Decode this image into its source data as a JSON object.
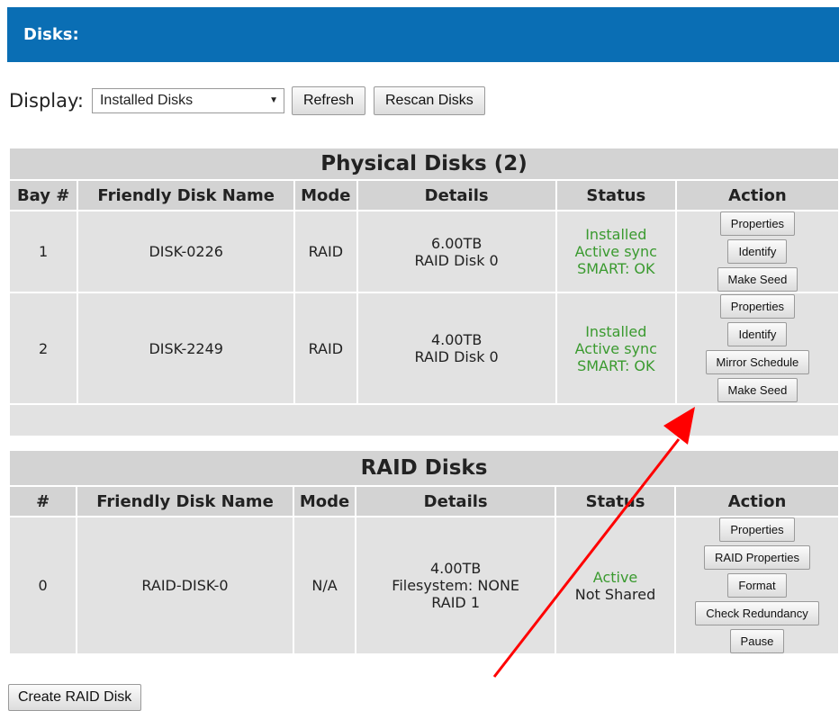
{
  "header": {
    "title": "Disks:"
  },
  "display": {
    "label": "Display:",
    "selected": "Installed Disks",
    "refresh_label": "Refresh",
    "rescan_label": "Rescan Disks"
  },
  "physical": {
    "caption": "Physical Disks (2)",
    "columns": [
      "Bay #",
      "Friendly Disk Name",
      "Mode",
      "Details",
      "Status",
      "Action"
    ],
    "rows": [
      {
        "bay": "1",
        "name": "DISK-0226",
        "mode": "RAID",
        "details": [
          "6.00TB",
          "RAID Disk 0"
        ],
        "status": [
          "Installed",
          "Active sync",
          "SMART: OK"
        ],
        "actions": [
          "Properties",
          "Identify",
          "Make Seed"
        ]
      },
      {
        "bay": "2",
        "name": "DISK-2249",
        "mode": "RAID",
        "details": [
          "4.00TB",
          "RAID Disk 0"
        ],
        "status": [
          "Installed",
          "Active sync",
          "SMART: OK"
        ],
        "actions": [
          "Properties",
          "Identify",
          "Mirror Schedule",
          "Make Seed"
        ]
      }
    ]
  },
  "raid": {
    "caption": "RAID Disks",
    "columns": [
      "#",
      "Friendly Disk Name",
      "Mode",
      "Details",
      "Status",
      "Action"
    ],
    "rows": [
      {
        "num": "0",
        "name": "RAID-DISK-0",
        "mode": "N/A",
        "details": [
          "4.00TB",
          "Filesystem: NONE",
          "RAID 1"
        ],
        "status_active": "Active",
        "status_shared": "Not Shared",
        "actions": [
          "Properties",
          "RAID Properties",
          "Format",
          "Check Redundancy",
          "Pause"
        ]
      }
    ]
  },
  "footer": {
    "create_label": "Create RAID Disk"
  },
  "colors": {
    "header_bg": "#0a6eb4",
    "status_green": "#3a9a2f",
    "annotation_arrow": "#ff0000"
  }
}
